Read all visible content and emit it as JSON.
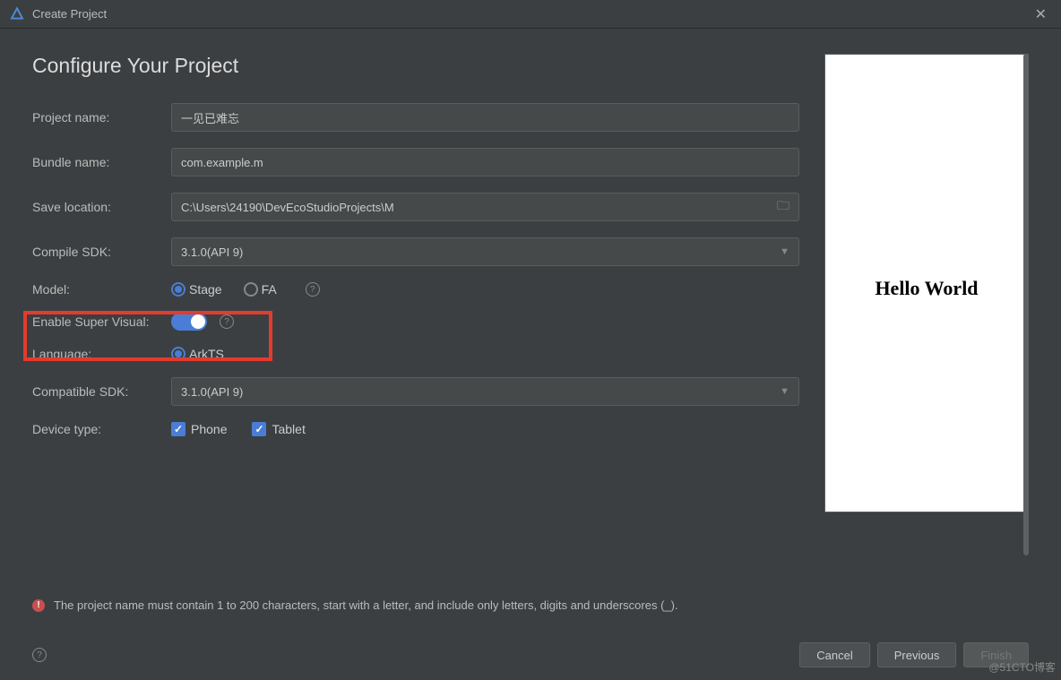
{
  "titlebar": {
    "title": "Create Project"
  },
  "page": {
    "heading": "Configure Your Project"
  },
  "labels": {
    "project_name": "Project name:",
    "bundle_name": "Bundle name:",
    "save_location": "Save location:",
    "compile_sdk": "Compile SDK:",
    "model": "Model:",
    "enable_super_visual": "Enable Super Visual:",
    "language": "Language:",
    "compatible_sdk": "Compatible SDK:",
    "device_type": "Device type:"
  },
  "fields": {
    "project_name": "一见已难忘",
    "bundle_name": "com.example.m",
    "save_location": "C:\\Users\\24190\\DevEcoStudioProjects\\M",
    "compile_sdk": "3.1.0(API 9)",
    "compatible_sdk": "3.1.0(API 9)"
  },
  "model": {
    "stage": "Stage",
    "fa": "FA",
    "selected": "stage"
  },
  "language": {
    "arkts": "ArkTS"
  },
  "device": {
    "phone": "Phone",
    "tablet": "Tablet"
  },
  "preview": {
    "text": "Hello World"
  },
  "error": {
    "text": "The project name must contain 1 to 200 characters, start with a letter, and include only letters, digits and underscores (_)."
  },
  "buttons": {
    "cancel": "Cancel",
    "previous": "Previous",
    "finish": "Finish"
  },
  "watermark": "@51CTO博客"
}
